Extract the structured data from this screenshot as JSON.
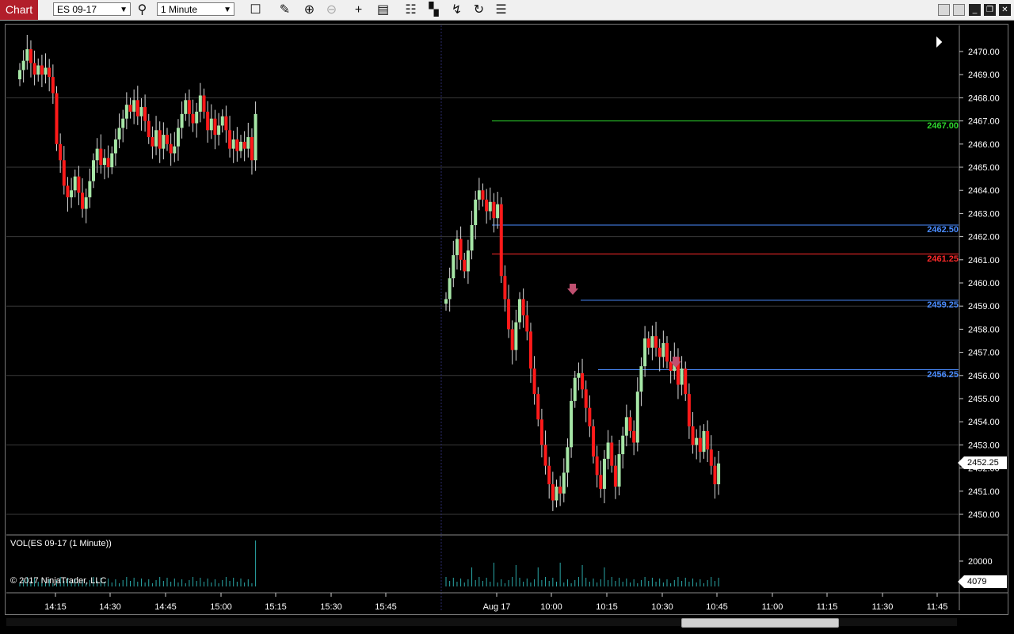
{
  "toolbar": {
    "tab_label": "Chart",
    "instrument": "ES 09-17",
    "interval": "1 Minute",
    "icons": [
      "search-icon",
      "box-icon",
      "pencil-icon",
      "zoom-in-icon",
      "zoom-out-icon",
      "crosshair-icon",
      "data-box-icon",
      "bars-icon",
      "strategies-icon",
      "indicators-icon",
      "reload-icon",
      "properties-icon"
    ]
  },
  "chart": {
    "price_axis": [
      "2470.00",
      "2469.00",
      "2468.00",
      "2467.00",
      "2466.00",
      "2465.00",
      "2464.00",
      "2463.00",
      "2462.00",
      "2461.00",
      "2460.00",
      "2459.00",
      "2458.00",
      "2457.00",
      "2456.00",
      "2455.00",
      "2454.00",
      "2453.00",
      "2452.00",
      "2451.00",
      "2450.00"
    ],
    "time_axis": [
      "14:15",
      "14:30",
      "14:45",
      "15:00",
      "15:15",
      "15:30",
      "15:45",
      "Aug 17",
      "10:00",
      "10:15",
      "10:30",
      "10:45",
      "11:00",
      "11:15",
      "11:30",
      "11:45"
    ],
    "levels": [
      {
        "label": "2467.00",
        "value": 2467.0,
        "color": "#2dd52d"
      },
      {
        "label": "2462.50",
        "value": 2462.5,
        "color": "#4a8cff"
      },
      {
        "label": "2461.25",
        "value": 2461.25,
        "color": "#ff2a2a"
      },
      {
        "label": "2459.25",
        "value": 2459.25,
        "color": "#4a8cff"
      },
      {
        "label": "2456.25",
        "value": 2456.25,
        "color": "#4a8cff"
      }
    ],
    "last_price": "2452.25",
    "up_color": "#a6e6a6",
    "down_color": "#ff1a1a",
    "volume_title": "VOL(ES 09-17 (1 Minute))",
    "volume_axis": "20000",
    "last_volume": "4079",
    "copyright": "© 2017 NinjaTrader, LLC"
  },
  "chart_data": {
    "type": "candlestick",
    "ylim": [
      2449.5,
      2470.5
    ],
    "closes": [
      2469.2,
      2469.6,
      2470.1,
      2469.5,
      2469.0,
      2469.4,
      2469.0,
      2469.3,
      2468.9,
      2468.2,
      2466.0,
      2465.3,
      2464.2,
      2463.7,
      2464.0,
      2464.6,
      2463.9,
      2463.2,
      2463.7,
      2464.4,
      2465.3,
      2465.8,
      2465.1,
      2465.4,
      2465.0,
      2465.6,
      2466.2,
      2466.7,
      2467.1,
      2467.7,
      2467.4,
      2467.9,
      2467.2,
      2467.6,
      2467.0,
      2466.3,
      2465.9,
      2466.6,
      2465.8,
      2466.4,
      2466.0,
      2465.6,
      2465.9,
      2466.7,
      2467.3,
      2467.9,
      2467.3,
      2466.9,
      2467.4,
      2468.1,
      2467.4,
      2466.6,
      2467.1,
      2466.4,
      2466.8,
      2467.2,
      2466.6,
      2465.8,
      2466.2,
      2465.7,
      2466.1,
      2465.8,
      2466.3,
      2465.3,
      2467.3,
      2459.3,
      2460.2,
      2461.2,
      2461.9,
      2461.0,
      2460.5,
      2461.4,
      2462.5,
      2463.6,
      2464.0,
      2463.6,
      2463.1,
      2463.5,
      2462.8,
      2463.4,
      2460.3,
      2459.3,
      2458.0,
      2457.1,
      2458.3,
      2459.3,
      2458.6,
      2457.9,
      2456.3,
      2455.2,
      2454.1,
      2453.0,
      2452.1,
      2451.3,
      2450.6,
      2451.2,
      2450.9,
      2451.8,
      2452.9,
      2454.9,
      2455.9,
      2456.1,
      2455.4,
      2454.6,
      2453.8,
      2452.5,
      2451.7,
      2451.1,
      2452.4,
      2453.1,
      2452.1,
      2451.2,
      2452.6,
      2453.4,
      2454.2,
      2453.6,
      2453.1,
      2455.3,
      2456.4,
      2457.6,
      2457.2,
      2457.7,
      2457.2,
      2456.8,
      2457.4,
      2456.6,
      2456.2,
      2456.8,
      2455.6,
      2456.3,
      2455.2,
      2453.8,
      2453.0,
      2453.3,
      2452.7,
      2453.6,
      2452.8,
      2452.1,
      2451.3,
      2452.2
    ],
    "volume_axis_label": "20000",
    "last_volume": "4079"
  }
}
